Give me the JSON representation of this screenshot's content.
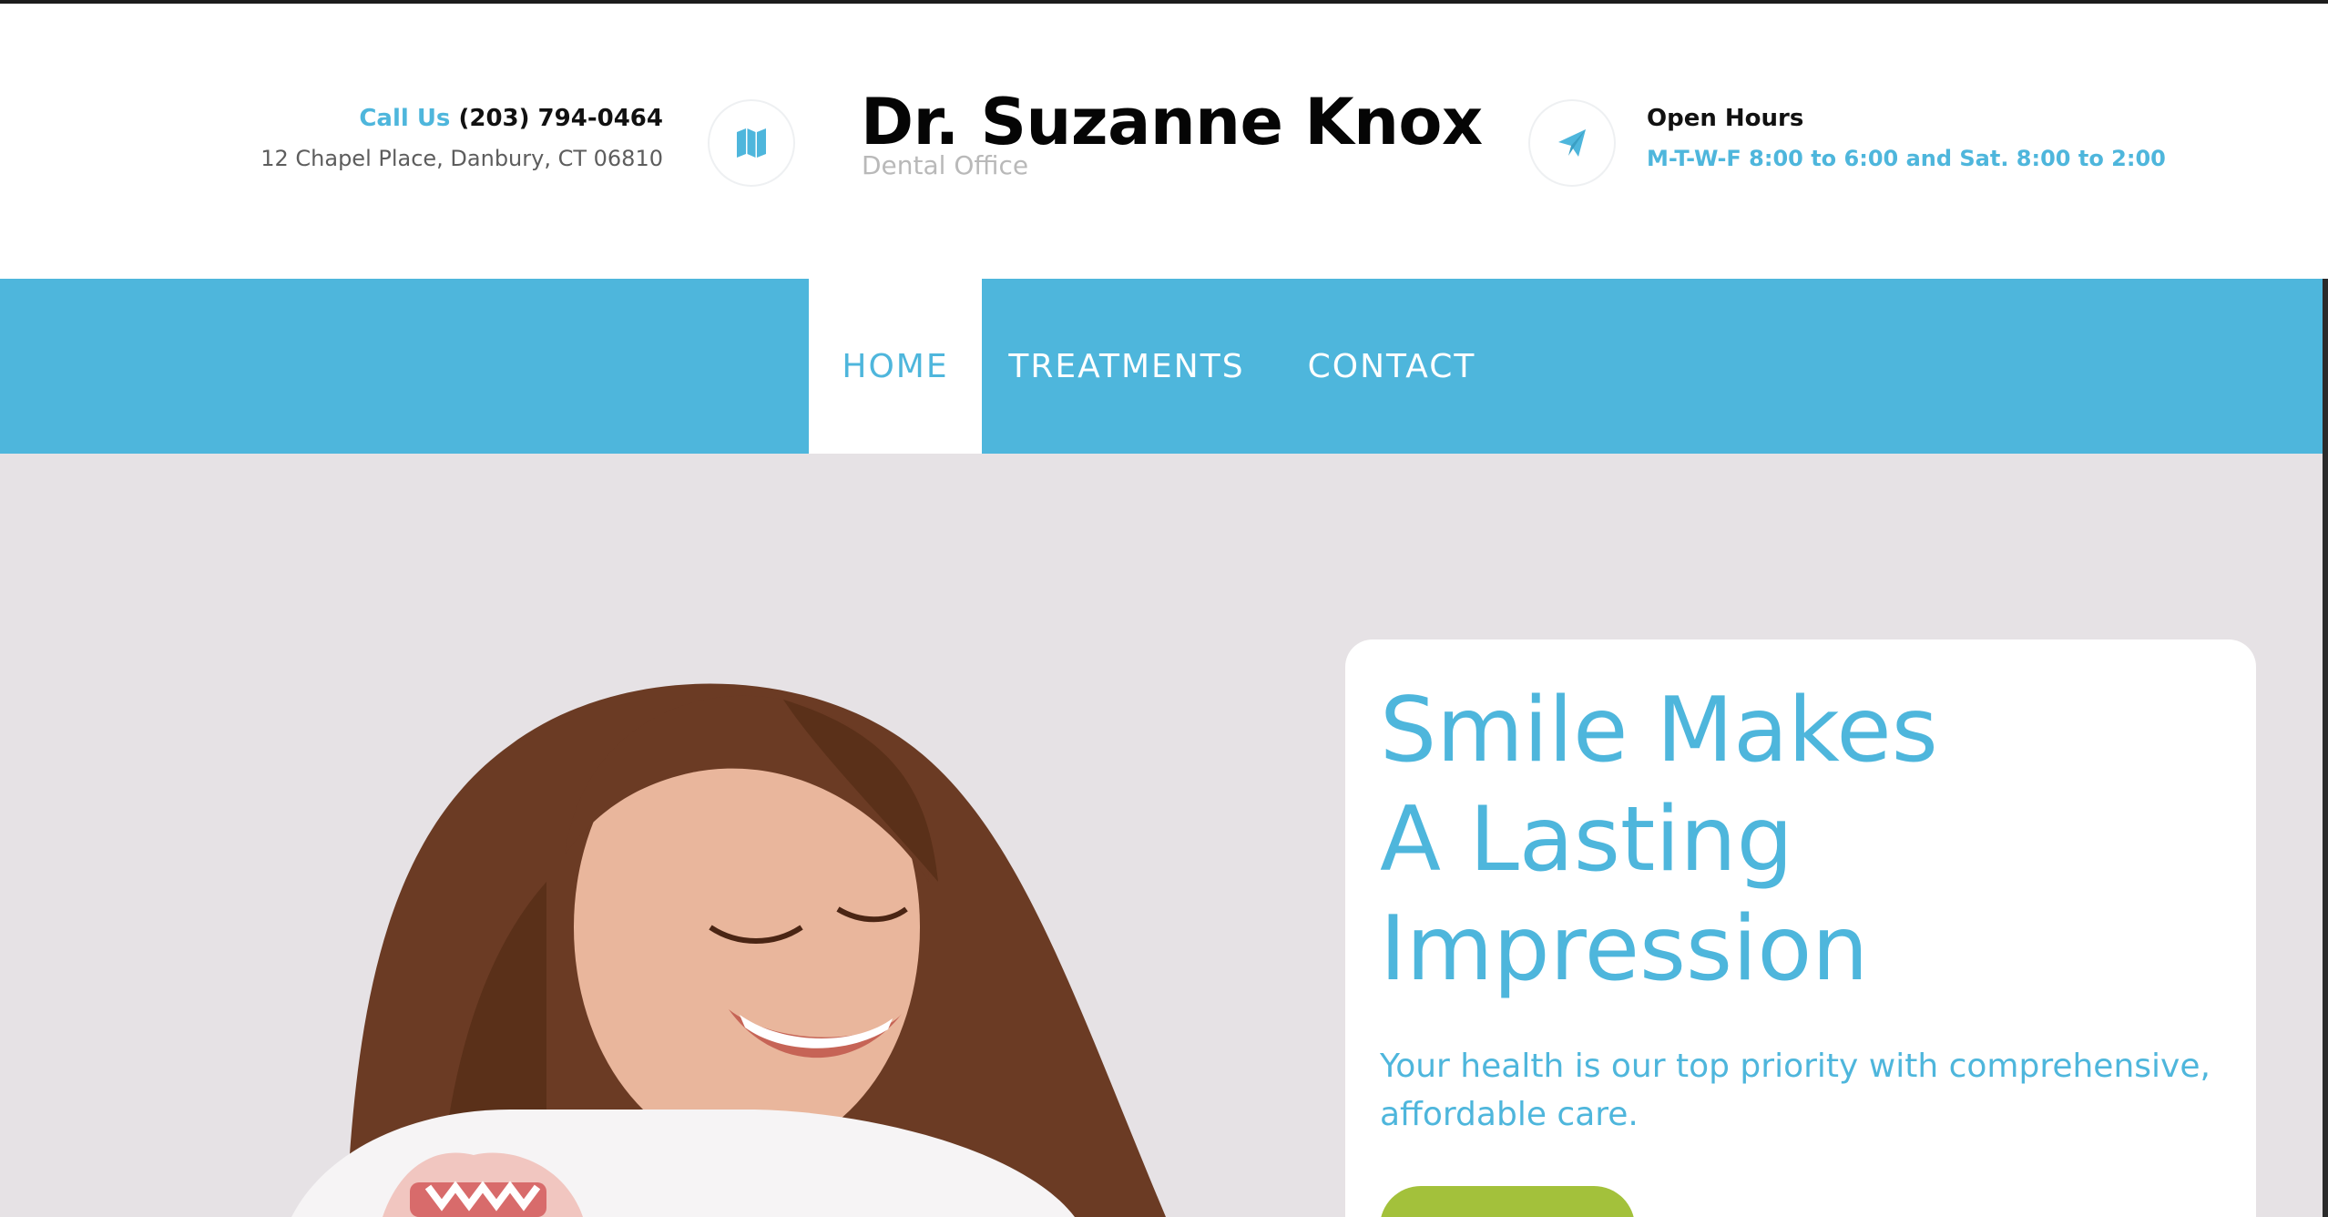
{
  "header": {
    "call_label": "Call Us",
    "phone": "(203) 794-0464",
    "address": "12 Chapel Place, Danbury, CT 06810",
    "brand_name": "Dr. Suzanne Knox",
    "brand_subtitle": "Dental Office",
    "hours_title": "Open Hours",
    "hours_text": "M-T-W-F 8:00 to 6:00 and Sat. 8:00 to 2:00",
    "icons": [
      "map-icon",
      "paper-plane-icon"
    ]
  },
  "nav": {
    "items": [
      {
        "label": "HOME",
        "active": true
      },
      {
        "label": "TREATMENTS",
        "active": false
      },
      {
        "label": "CONTACT",
        "active": false
      }
    ]
  },
  "hero": {
    "title_lines": [
      "Smile Makes",
      "A Lasting",
      "Impression"
    ],
    "subtitle": "Your health is our top priority with comprehensive, affordable care."
  },
  "colors": {
    "accent": "#4eb6dc",
    "cta": "#a3c13b",
    "hero_bg": "#e6e2e5"
  }
}
